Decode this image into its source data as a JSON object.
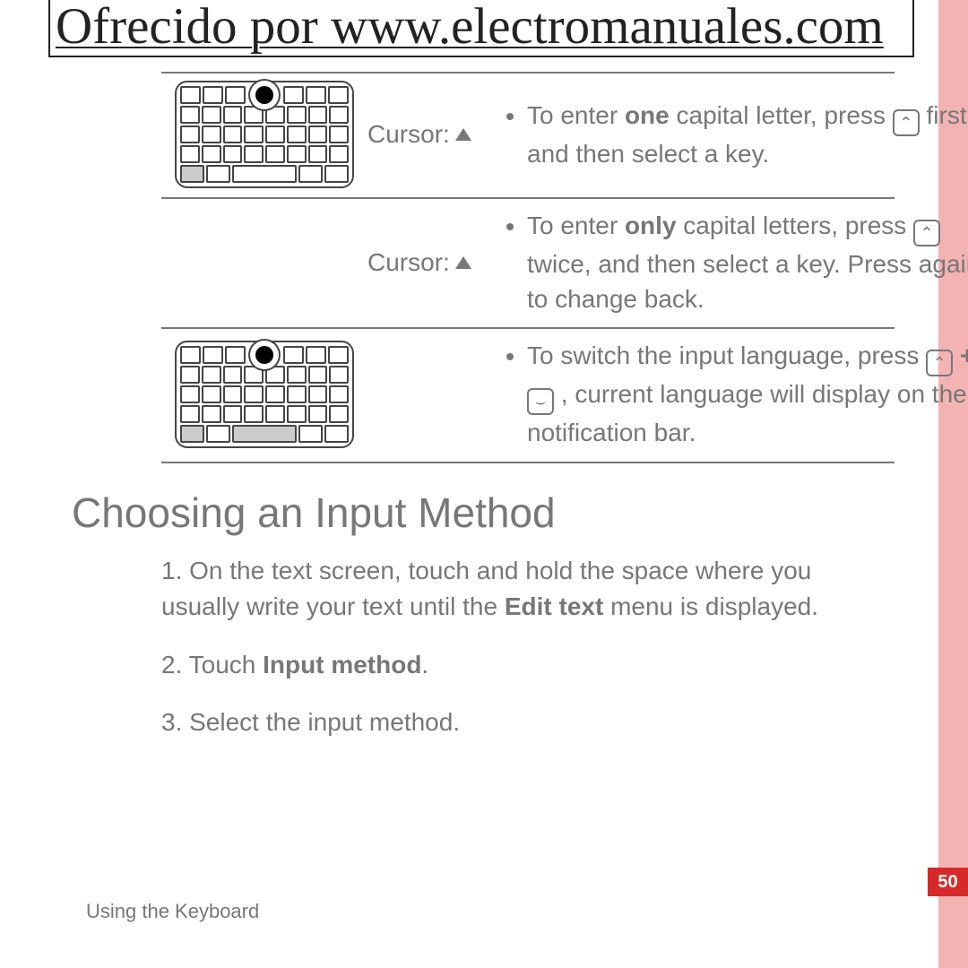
{
  "banner": "Ofrecido por www.electromanuales.com",
  "cursor_label": "Cursor:",
  "rows": {
    "r1": {
      "prefix": "To enter ",
      "bold": "one",
      "mid": " capital letter, press ",
      "after_key": " first, and then select a key."
    },
    "r2": {
      "prefix": "To enter ",
      "bold": "only",
      "mid": " capital letters, press ",
      "after_key": " twice, and then select a key. Press again to change back."
    },
    "r3": {
      "prefix": "To switch the input language, press ",
      "plus": " + ",
      "after": " , current language will display on the notification bar."
    }
  },
  "heading": "Choosing an Input Method",
  "steps": {
    "s1a": "1. On the text screen, touch and hold the space where you usually write your text until the ",
    "s1b": "Edit text",
    "s1c": " menu is displayed.",
    "s2a": "2. Touch ",
    "s2b": "Input method",
    "s2c": ".",
    "s3": "3. Select the input method."
  },
  "section": "Using the Keyboard",
  "page": "50",
  "icons": {
    "shift_glyph": "⌃",
    "space_glyph": "⌣"
  }
}
